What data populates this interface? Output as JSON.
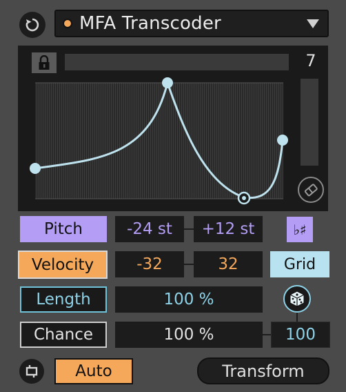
{
  "header": {
    "device_name": "MFA Transcoder",
    "refresh_icon": "refresh-icon",
    "dropdown_icon": "chevron-down-icon"
  },
  "editor": {
    "lock_icon": "lock-icon",
    "point_count": "7",
    "erase_icon": "eraser-icon"
  },
  "rows": {
    "pitch": {
      "label": "Pitch",
      "min": "-24 st",
      "max": "+12 st",
      "scale_label": "♭♯"
    },
    "velocity": {
      "label": "Velocity",
      "min": "-32",
      "max": "32",
      "grid_label": "Grid"
    },
    "length": {
      "label": "Length",
      "value": "100 %",
      "dice_icon": "dice-icon"
    },
    "chance": {
      "label": "Chance",
      "value": "100 %",
      "seed": "100"
    }
  },
  "footer": {
    "loop_icon": "loop-icon",
    "auto_label": "Auto",
    "transform_label": "Transform"
  },
  "colors": {
    "purple": "#b49ef5",
    "orange": "#f6a85a",
    "cyan": "#8ed3e8",
    "curve": "#bfe3ee",
    "background": "#4a4a4a"
  }
}
